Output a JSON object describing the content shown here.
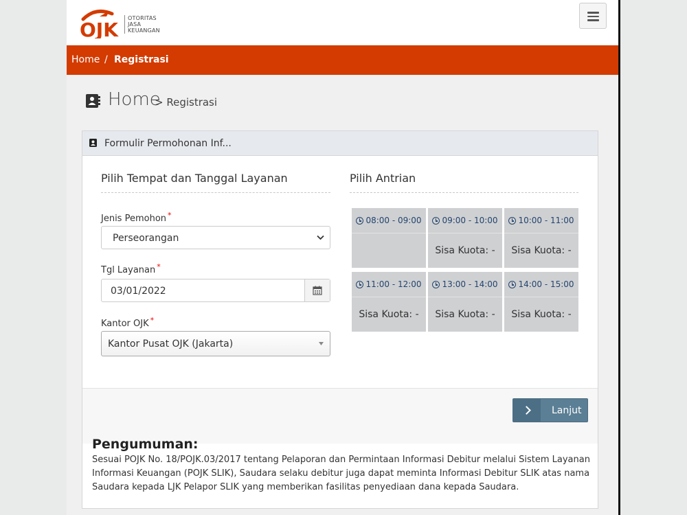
{
  "header": {
    "logo_letters": "OJK",
    "logo_line1": "OTORITAS",
    "logo_line2": "JASA",
    "logo_line3": "KEUANGAN",
    "brand_color": "#d33b00"
  },
  "breadcrumb": {
    "home": "Home",
    "separator": "/",
    "current": "Registrasi"
  },
  "page_title": {
    "main": "Home",
    "sub": "> Registrasi"
  },
  "panel": {
    "title": "Formulir Permohonan Inf..."
  },
  "left_section": {
    "title": "Pilih Tempat dan Tanggal Layanan",
    "jenis_pemohon_label": "Jenis Pemohon",
    "jenis_pemohon_value": "Perseorangan",
    "tgl_layanan_label": "Tgl Layanan",
    "tgl_layanan_value": "03/01/2022",
    "kantor_label": "Kantor OJK",
    "kantor_value": "Kantor Pusat OJK (Jakarta)",
    "required_mark": "*"
  },
  "right_section": {
    "title": "Pilih Antrian",
    "slots": [
      {
        "time": "08:00 - 09:00",
        "kuota": ""
      },
      {
        "time": "09:00 - 10:00",
        "kuota": "Sisa Kuota: -"
      },
      {
        "time": "10:00 - 11:00",
        "kuota": "Sisa Kuota: -"
      },
      {
        "time": "11:00 - 12:00",
        "kuota": "Sisa Kuota: -"
      },
      {
        "time": "13:00 - 14:00",
        "kuota": "Sisa Kuota: -"
      },
      {
        "time": "14:00 - 15:00",
        "kuota": "Sisa Kuota: -"
      }
    ]
  },
  "actions": {
    "next_label": "Lanjut"
  },
  "announcement": {
    "title": "Pengumuman:",
    "text": "Sesuai POJK No. 18/POJK.03/2017 tentang Pelaporan dan Permintaan Informasi Debitur melalui Sistem Layanan Informasi Keuangan (POJK SLIK), Saudara selaku debitur juga dapat meminta Informasi Debitur SLIK atas nama Saudara kepada LJK Pelapor SLIK yang memberikan fasilitas penyediaan dana kepada Saudara."
  }
}
